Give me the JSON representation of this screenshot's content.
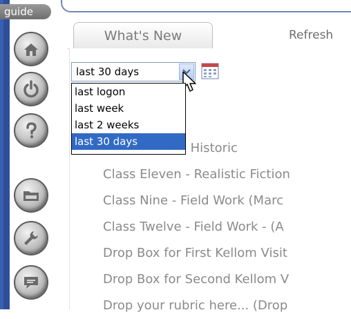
{
  "rail": {
    "guide_label": "guide",
    "buttons": [
      {
        "name": "home",
        "icon": "home-icon"
      },
      {
        "name": "power",
        "icon": "power-icon"
      },
      {
        "name": "help",
        "icon": "help-icon"
      },
      {
        "name": "folder",
        "icon": "folder-icon"
      },
      {
        "name": "tools",
        "icon": "wrench-icon"
      },
      {
        "name": "chat",
        "icon": "chat-icon"
      }
    ]
  },
  "tabs": {
    "active": "What's New",
    "refresh": "Refresh"
  },
  "filter": {
    "selected": "last 30 days",
    "options": [
      "last logon",
      "last week",
      "last 2 weeks",
      "last 30 days"
    ]
  },
  "items": [
    "Class Seven - Historic",
    "Class Eleven - Realistic Fiction",
    "Class Nine - Field Work (Marc",
    "Class Twelve - Field Work - (A",
    "Drop Box for First Kellom Visit",
    "Drop Box for Second Kellom V",
    "Drop your rubric here... (Drop"
  ],
  "colors": {
    "rail_blue": "#2e4f98",
    "selection": "#316ac5",
    "item_text": "#8a8a8a"
  }
}
